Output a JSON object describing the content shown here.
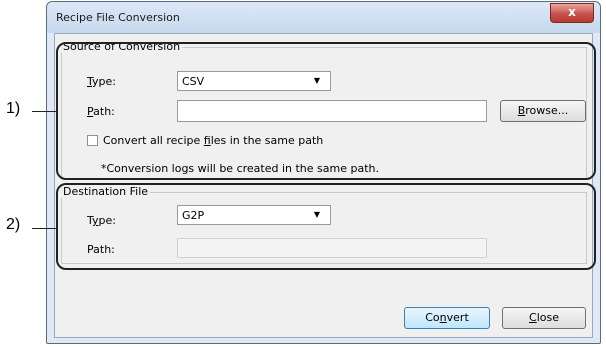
{
  "window": {
    "title": "Recipe File Conversion",
    "close_glyph": "x"
  },
  "source": {
    "group_label": "Source of Conversion",
    "type": {
      "label_pre": "",
      "label_ul": "T",
      "label_post": "ype:",
      "value": "CSV"
    },
    "path": {
      "label_pre": "",
      "label_ul": "P",
      "label_post": "ath:",
      "value": ""
    },
    "browse": {
      "pre": "",
      "ul": "B",
      "post": "rowse..."
    },
    "convert_all": {
      "pre": "Convert all recipe ",
      "ul": "f",
      "post": "iles in the same path",
      "checked": false
    },
    "note": "*Conversion logs will be created in the same path."
  },
  "destination": {
    "group_label": "Destination File",
    "type": {
      "label_pre": "T",
      "label_ul": "y",
      "label_post": "pe:",
      "value": "G2P"
    },
    "path": {
      "label": "Path:",
      "value": ""
    }
  },
  "buttons": {
    "convert": {
      "pre": "Co",
      "ul": "n",
      "post": "vert"
    },
    "close": {
      "pre": "",
      "ul": "C",
      "post": "lose"
    }
  },
  "annotations": {
    "marker_1": "1)",
    "marker_2": "2)"
  }
}
